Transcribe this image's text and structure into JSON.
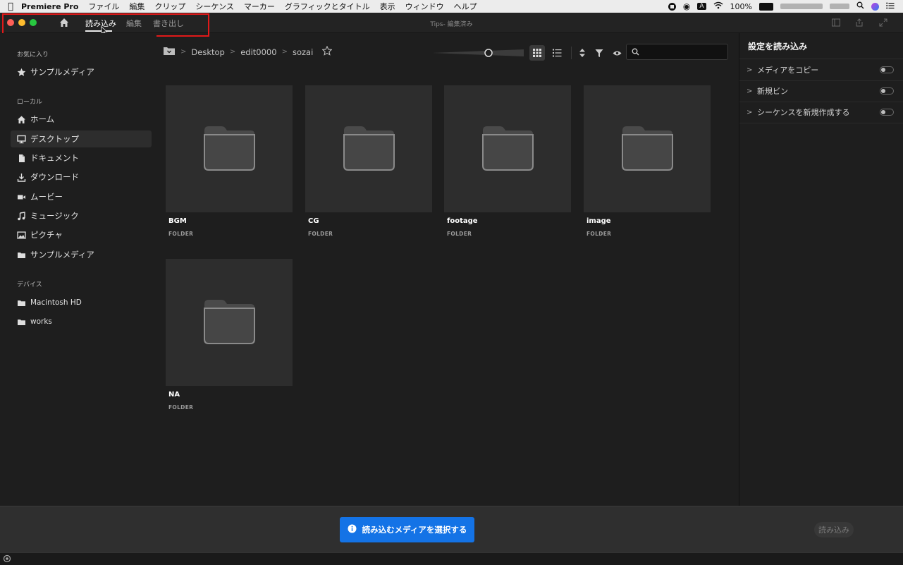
{
  "menubar": {
    "app_name": "Premiere Pro",
    "items": [
      "ファイル",
      "編集",
      "クリップ",
      "シーケンス",
      "マーカー",
      "グラフィックとタイトル",
      "表示",
      "ウィンドウ",
      "ヘルプ"
    ],
    "input_mode": "A",
    "battery": "100%"
  },
  "header": {
    "tabs": [
      {
        "label": "読み込み",
        "active": true
      },
      {
        "label": "編集",
        "active": false
      },
      {
        "label": "書き出し",
        "active": false
      }
    ],
    "window_title": "Tips- 編集済み"
  },
  "sidebar": {
    "favorites_title": "お気に入り",
    "favorites": [
      {
        "label": "サンプルメディア",
        "icon": "star-icon"
      }
    ],
    "local_title": "ローカル",
    "local": [
      {
        "label": "ホーム",
        "icon": "home-icon"
      },
      {
        "label": "デスクトップ",
        "icon": "desktop-icon",
        "selected": true
      },
      {
        "label": "ドキュメント",
        "icon": "document-icon"
      },
      {
        "label": "ダウンロード",
        "icon": "download-icon"
      },
      {
        "label": "ムービー",
        "icon": "movie-icon"
      },
      {
        "label": "ミュージック",
        "icon": "music-icon"
      },
      {
        "label": "ピクチャ",
        "icon": "picture-icon"
      },
      {
        "label": "サンプルメディア",
        "icon": "folder-icon"
      }
    ],
    "devices_title": "デバイス",
    "devices": [
      {
        "label": "Macintosh HD",
        "icon": "folder-icon"
      },
      {
        "label": "works",
        "icon": "folder-icon"
      }
    ]
  },
  "breadcrumb": [
    "Desktop",
    "edit0000",
    "sozai"
  ],
  "search": {
    "placeholder": ""
  },
  "folders": [
    {
      "name": "BGM",
      "type": "FOLDER"
    },
    {
      "name": "CG",
      "type": "FOLDER"
    },
    {
      "name": "footage",
      "type": "FOLDER"
    },
    {
      "name": "image",
      "type": "FOLDER"
    },
    {
      "name": "NA",
      "type": "FOLDER"
    }
  ],
  "right_panel": {
    "title": "設定を読み込み",
    "options": [
      {
        "label": "メディアをコピー",
        "enabled": false
      },
      {
        "label": "新規ビン",
        "enabled": false
      },
      {
        "label": "シーケンスを新規作成する",
        "enabled": false
      }
    ]
  },
  "footer": {
    "select_media_label": "読み込むメディアを選択する",
    "import_label": "読み込み"
  },
  "colors": {
    "accent": "#1473e6",
    "highlight_box": "#e11919",
    "background": "#1e1e1e"
  }
}
